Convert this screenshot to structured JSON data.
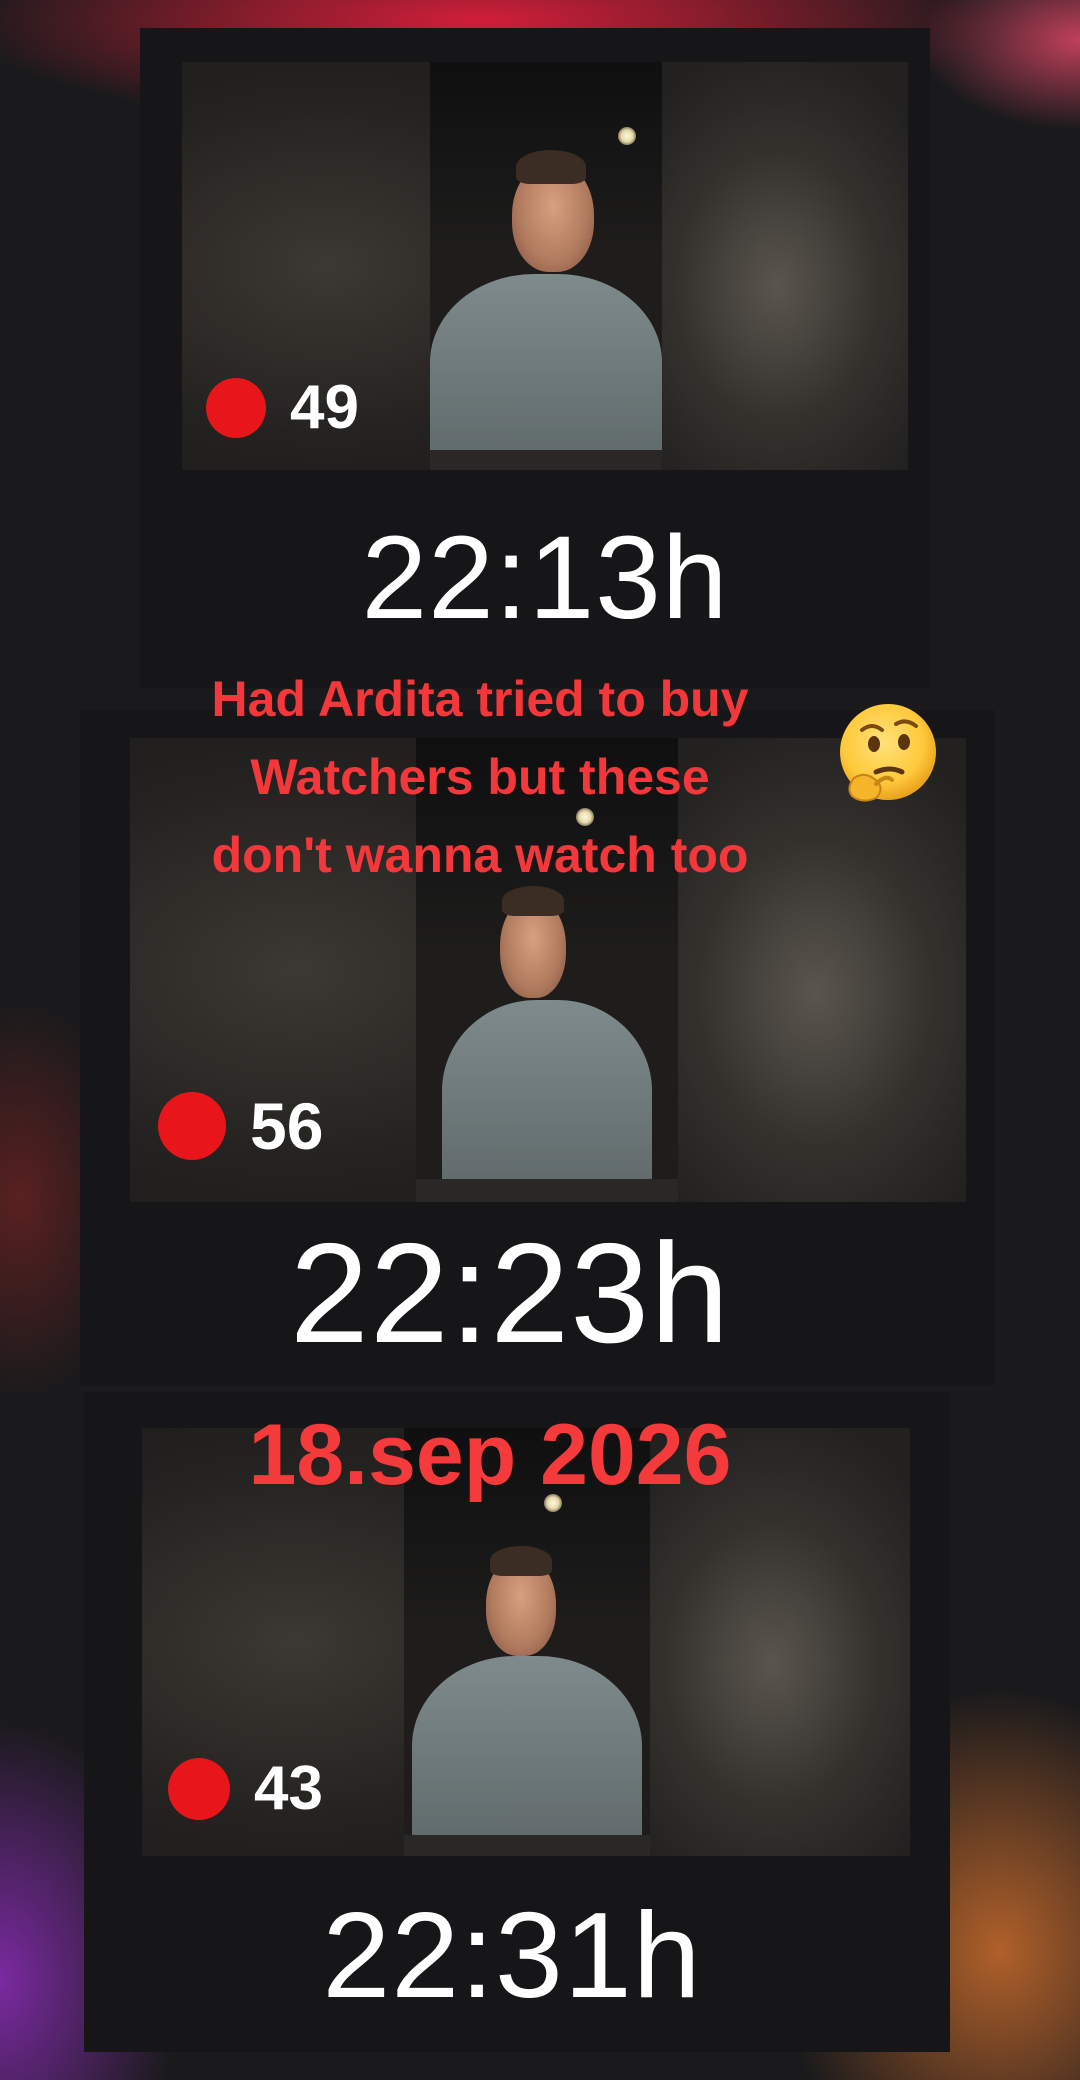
{
  "frames": [
    {
      "viewers": "49",
      "time": "22:13h"
    },
    {
      "viewers": "56",
      "time": "22:23h"
    },
    {
      "viewers": "43",
      "time": "22:31h"
    }
  ],
  "caption": {
    "lines": [
      "Had Ardita tried to buy",
      "Watchers but these",
      "don't wanna watch too"
    ]
  },
  "date": "18.sep 2026",
  "icons": {
    "live_indicator": "red-dot",
    "reaction": "thinking-face-emoji"
  },
  "colors": {
    "caption": "#f4373a",
    "live_dot": "#e8161b",
    "timestamp": "#ffffff",
    "count": "#ffffff"
  }
}
